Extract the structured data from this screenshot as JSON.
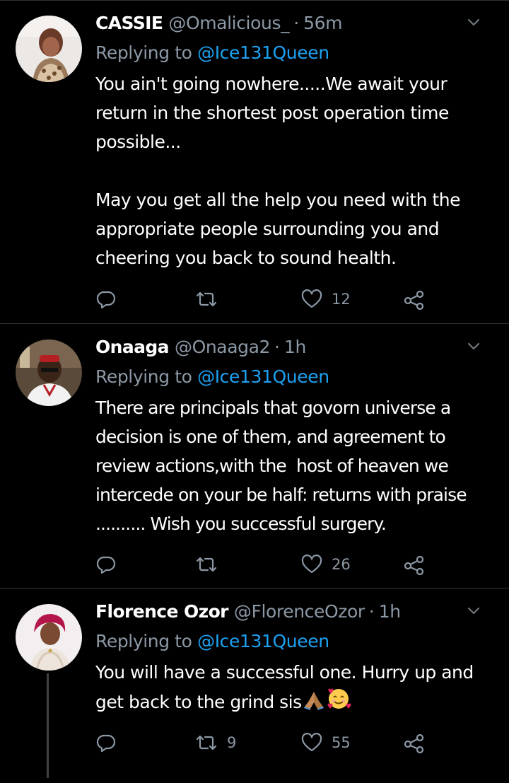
{
  "colors": {
    "background": "#000000",
    "text": "#ffffff",
    "muted": "#8b98a5",
    "link": "#1da1f2",
    "divider": "#2f3336"
  },
  "tweets": [
    {
      "name": "CASSIE",
      "handle": "@Omalicious_",
      "separator": "·",
      "time": "56m",
      "replying_prefix": "Replying to ",
      "replying_to": "@Ice131Queen",
      "paragraphs": [
        "You ain't going nowhere.....We await your return in the shortest post operation time possible...",
        "May you get all the help you need with the appropriate people surrounding you and cheering you back to sound health."
      ],
      "reply_count": "",
      "retweet_count": "",
      "like_count": "12",
      "icons": [
        "reply-icon",
        "retweet-icon",
        "like-icon",
        "share-icon"
      ]
    },
    {
      "name": "Onaaga",
      "handle": "@Onaaga2",
      "separator": "·",
      "time": "1h",
      "replying_prefix": "Replying to ",
      "replying_to": "@Ice131Queen",
      "paragraphs": [
        "There are principals that govorn universe a decision is one of them, and agreement to review actions,with the  host of heaven we intercede on your be half: returns with praise .......... Wish you successful surgery."
      ],
      "reply_count": "",
      "retweet_count": "",
      "like_count": "26",
      "icons": [
        "reply-icon",
        "retweet-icon",
        "like-icon",
        "share-icon"
      ]
    },
    {
      "name": "Florence Ozor",
      "handle": "@FlorenceOzor",
      "separator": "·",
      "time": "1h",
      "replying_prefix": "Replying to ",
      "replying_to": "@Ice131Queen",
      "paragraphs": [
        "You will have a successful one. Hurry up and get back to the grind sis"
      ],
      "emojis": [
        "praying-hands-emoji",
        "smiling-face-with-hearts-emoji"
      ],
      "reply_count": "",
      "retweet_count": "9",
      "like_count": "55",
      "icons": [
        "reply-icon",
        "retweet-icon",
        "like-icon",
        "share-icon"
      ]
    }
  ]
}
